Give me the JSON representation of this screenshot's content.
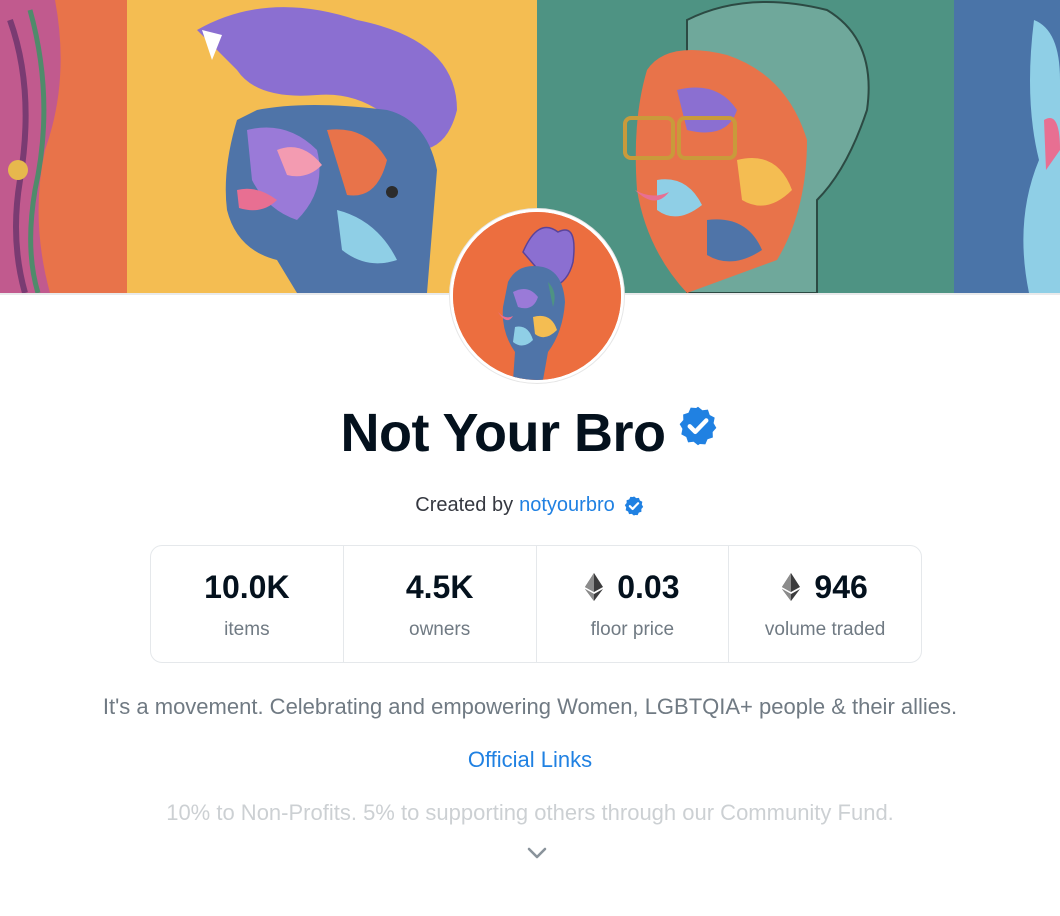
{
  "banner": {
    "panels": [
      {
        "color": "#e8734a"
      },
      {
        "color": "#f4bd52"
      },
      {
        "color": "#4e9383"
      },
      {
        "color": "#4a74a8"
      }
    ]
  },
  "collection": {
    "name": "Not Your Bro",
    "verified_icon": "verified-badge-icon",
    "created_by_label": "Created by",
    "creator": "notyourbro"
  },
  "stats": [
    {
      "value": "10.0K",
      "label": "items",
      "eth": false
    },
    {
      "value": "4.5K",
      "label": "owners",
      "eth": false
    },
    {
      "value": "0.03",
      "label": "floor price",
      "eth": true
    },
    {
      "value": "946",
      "label": "volume traded",
      "eth": true
    }
  ],
  "description": "It's a movement. Celebrating and empowering Women, LGBTQIA+ people & their allies.",
  "links_label": "Official Links",
  "faded_text": "10% to Non-Profits. 5% to supporting others through our Community Fund.",
  "expand_icon": "chevron-down-icon",
  "colors": {
    "accent": "#2081e2",
    "verified": "#2081e2",
    "text_primary": "#04111d",
    "text_secondary": "#707a83"
  }
}
